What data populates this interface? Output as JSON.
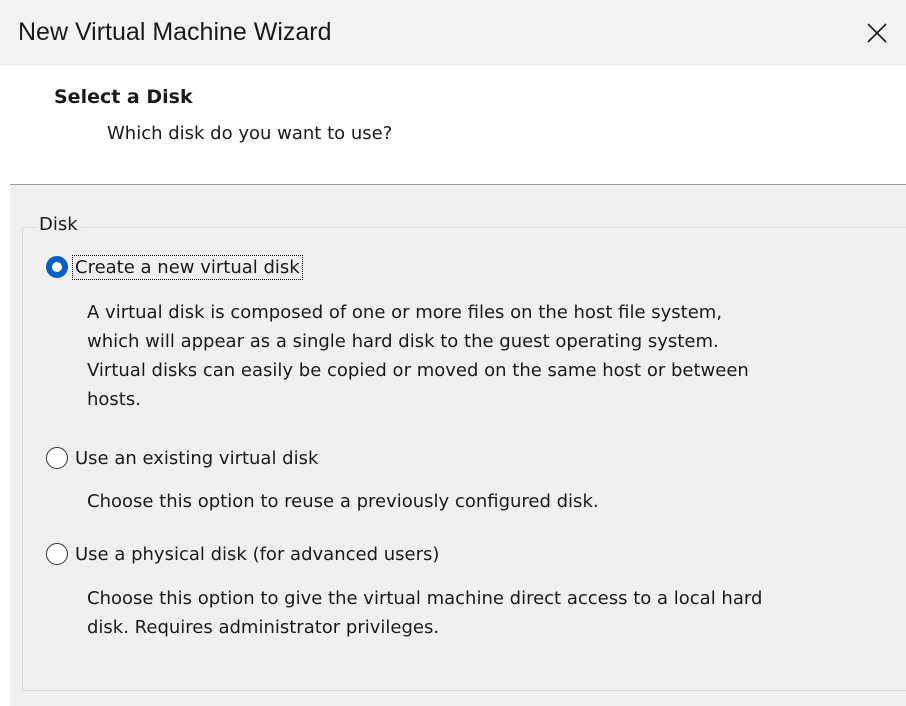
{
  "window": {
    "title": "New Virtual Machine Wizard",
    "close_icon": "close-icon"
  },
  "header": {
    "title": "Select a Disk",
    "subtitle": "Which disk do you want to use?"
  },
  "disk_group": {
    "legend": "Disk",
    "options": [
      {
        "label": "Create a new virtual disk",
        "selected": true,
        "description_lines": [
          "A virtual disk is composed of one or more files on the host file system,",
          "which will appear as a single hard disk to the guest operating system.",
          "Virtual disks can easily be copied or moved on the same host or between",
          "hosts."
        ]
      },
      {
        "label": "Use an existing virtual disk",
        "selected": false,
        "description_lines": [
          "Choose this option to reuse a previously configured disk."
        ]
      },
      {
        "label": "Use a physical disk (for advanced users)",
        "selected": false,
        "description_lines": [
          "Choose this option to give the virtual machine direct access to a local hard",
          "disk. Requires administrator privileges."
        ]
      }
    ]
  },
  "colors": {
    "accent": "#0a5fc4",
    "title_bar": "#f3f3f3",
    "body_bg": "#f0f0f0"
  }
}
